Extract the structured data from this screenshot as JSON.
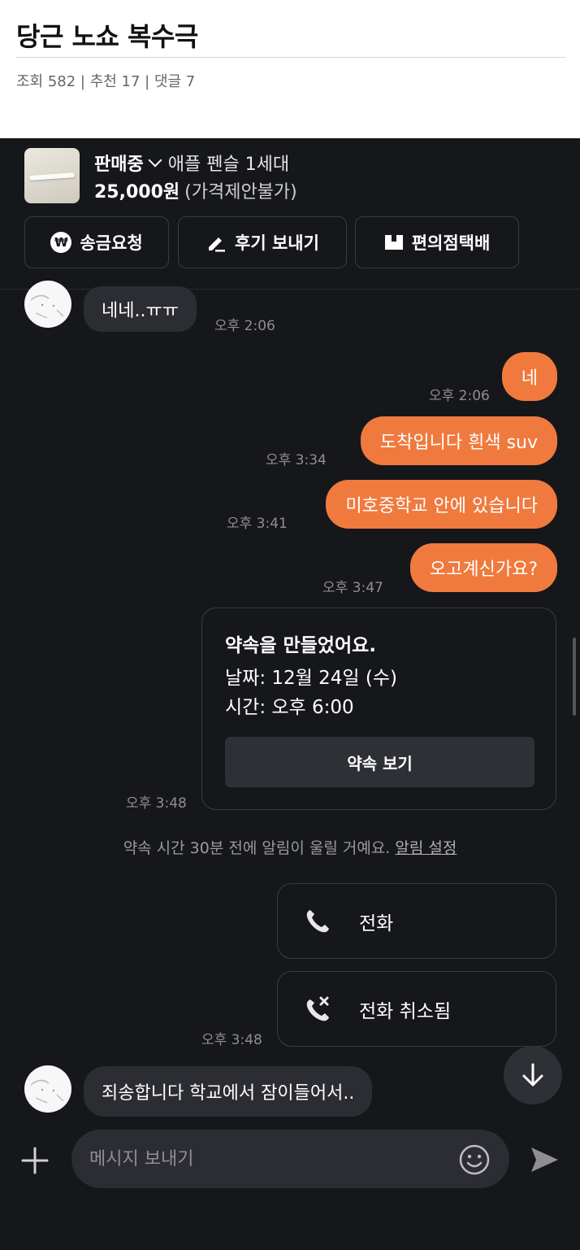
{
  "post": {
    "title": "당근 노쇼 복수극",
    "meta": "조회 582 | 추천 17 | 댓글 7"
  },
  "product": {
    "status": "판매중",
    "name": "애플 펜슬 1세대",
    "price": "25,000원",
    "price_note": "(가격제안불가)"
  },
  "actions": {
    "remit_label": "송금요청",
    "remit_icon": "won",
    "review_label": "후기 보내기",
    "delivery_label": "편의점택배"
  },
  "messages": [
    {
      "side": "in",
      "text": "네네..ㅠㅠ",
      "time": "오후 2:06"
    },
    {
      "side": "out",
      "text": "네",
      "time": "오후 2:06"
    },
    {
      "side": "out",
      "text": "도착입니다 흰색 suv",
      "time": "오후 3:34"
    },
    {
      "side": "out",
      "text": "미호중학교 안에 있습니다",
      "time": "오후 3:41"
    },
    {
      "side": "out",
      "text": "오고계신가요?",
      "time": "오후 3:47"
    }
  ],
  "appointment": {
    "title": "약속을 만들었어요.",
    "date": "날짜: 12월 24일 (수)",
    "time": "시간: 오후 6:00",
    "button": "약속 보기",
    "sent_time": "오후 3:48"
  },
  "notice": {
    "text": "약속 시간 30분 전에 알림이 울릴 거예요.",
    "link": "알림 설정"
  },
  "calls": {
    "call_label": "전화",
    "cancelled_label": "전화 취소됨",
    "time": "오후 3:48"
  },
  "last_message": {
    "text": "죄송합니다 학교에서 잠이들어서.."
  },
  "composer": {
    "placeholder": "메시지 보내기"
  },
  "colors": {
    "chat_bg": "#16171b",
    "bubble_out": "#f07a3e",
    "bubble_in": "#2c2d33"
  }
}
